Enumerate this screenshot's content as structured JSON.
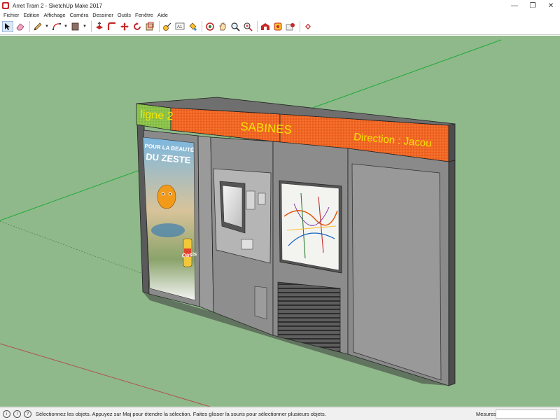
{
  "window": {
    "title": "Arret Tram 2 - SketchUp Make 2017",
    "minimize": "—",
    "maximize": "❐",
    "close": "✕"
  },
  "menu": [
    "Fichier",
    "Edition",
    "Affichage",
    "Caméra",
    "Dessiner",
    "Outils",
    "Fenêtre",
    "Aide"
  ],
  "toolbar": {
    "tools": [
      "select-icon",
      "eraser-icon",
      "pencil-line-icon",
      "arc-icon",
      "rectangle-icon",
      "push-pull-icon",
      "follow-me-icon",
      "move-icon",
      "rotate-icon",
      "scale-icon",
      "tape-measure-icon",
      "text-icon",
      "paint-bucket-icon",
      "orbit-icon",
      "pan-icon",
      "zoom-icon",
      "zoom-extents-icon",
      "warehouse-icon",
      "extension-icon",
      "add-location-icon"
    ]
  },
  "scene": {
    "line_label": "ligne 2",
    "stop_name": "SABINES",
    "direction": "Direction : Jacou",
    "ad_headline_1": "POUR LA BEAUTÉ",
    "ad_headline_2": "DU ZESTE",
    "ad_brand": "Oasis",
    "colors": {
      "ground": "#8fb98a",
      "green_band": "#7cb342",
      "orange_band": "#f26522",
      "sign_text": "#f5e400",
      "panel_gray": "#8e8e8e"
    }
  },
  "status": {
    "hint": "Sélectionnez les objets. Appuyez sur Maj pour étendre la sélection. Faites glisser la souris pour sélectionner plusieurs objets.",
    "measures_label": "Mesures",
    "measures_value": ""
  }
}
